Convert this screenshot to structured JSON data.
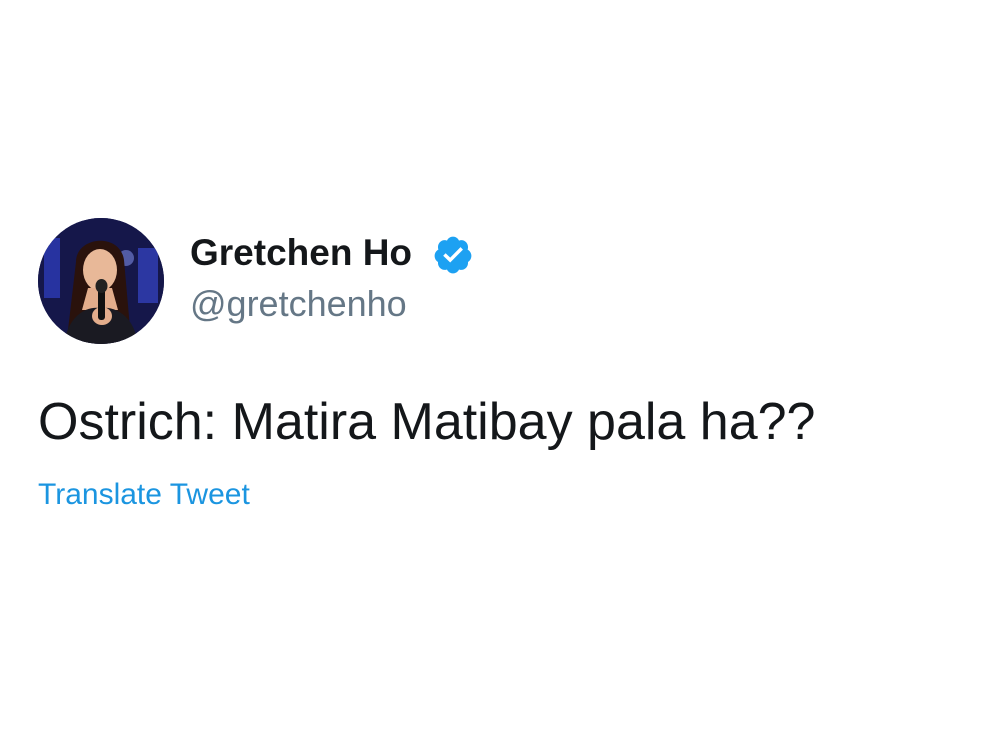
{
  "user": {
    "display_name": "Gretchen Ho",
    "handle": "@gretchenho",
    "verified_icon": "verified-badge-icon",
    "avatar": "avatar"
  },
  "tweet": {
    "text": "Ostrich: Matira Matibay pala ha??",
    "translate_label": "Translate Tweet"
  },
  "colors": {
    "name_text": "#14171a",
    "handle_text": "#657786",
    "link": "#1b95e0",
    "verified": "#1da1f2",
    "background": "#ffffff"
  }
}
